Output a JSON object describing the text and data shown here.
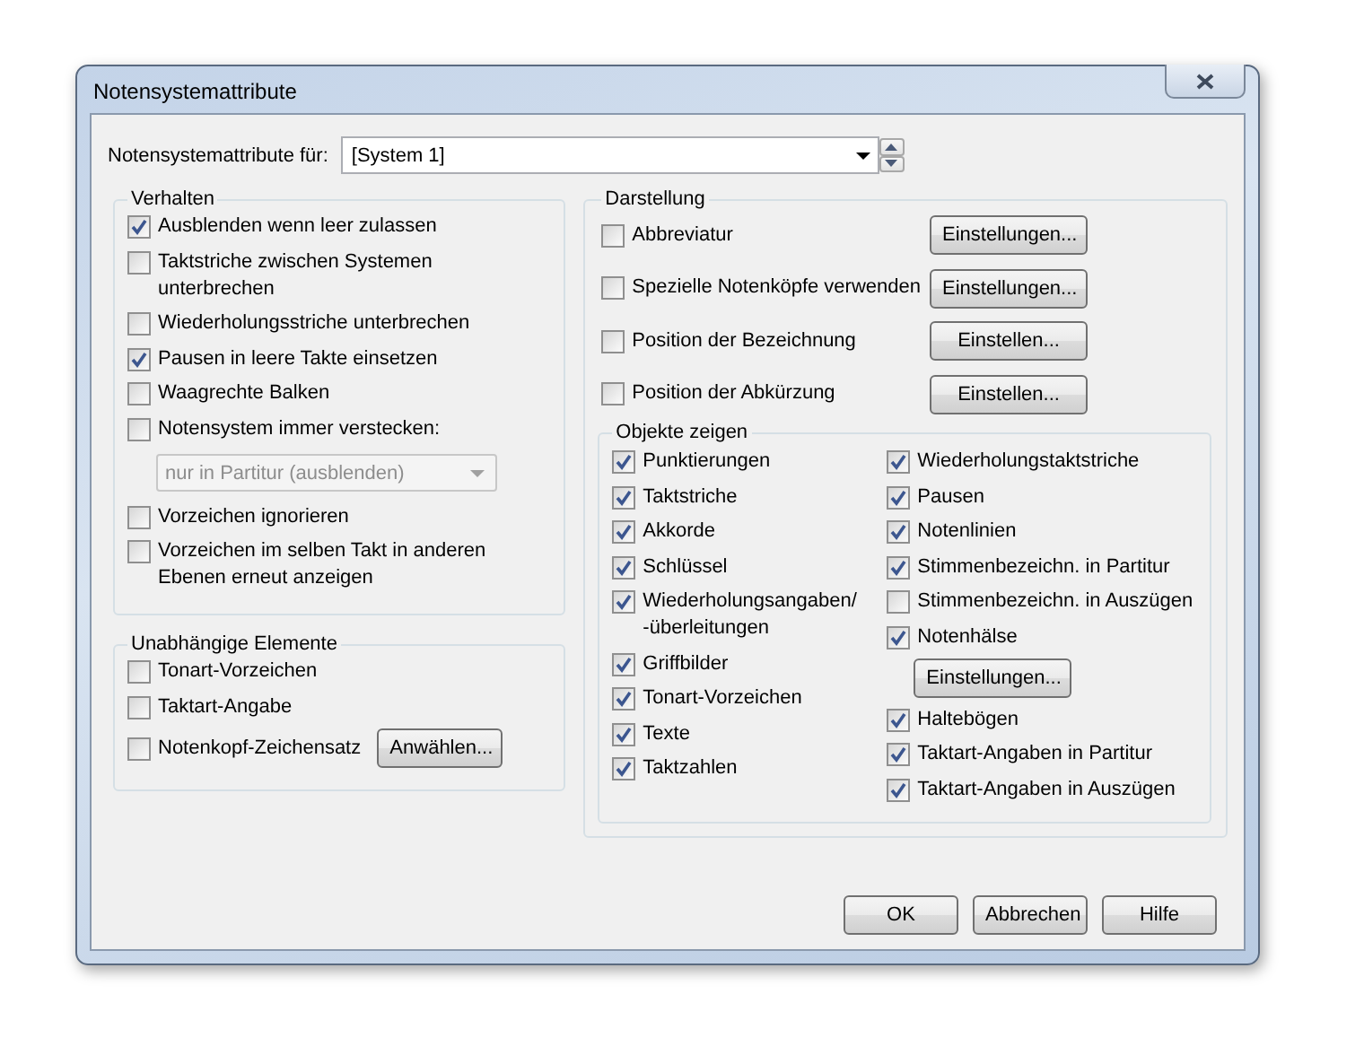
{
  "window": {
    "title": "Notensystemattribute"
  },
  "system_selector": {
    "label": "Notensystemattribute für:",
    "value": "[System 1]"
  },
  "behavior": {
    "title": "Verhalten",
    "items": [
      {
        "kind": "check",
        "label": "Ausblenden wenn leer zulassen",
        "checked": true
      },
      {
        "kind": "check",
        "label": "Taktstriche zwischen Systemen unterbrechen",
        "checked": false
      },
      {
        "kind": "check",
        "label": "Wiederholungsstriche unterbrechen",
        "checked": false
      },
      {
        "kind": "check",
        "label": "Pausen in leere Takte einsetzen",
        "checked": true
      },
      {
        "kind": "check",
        "label": "Waagrechte Balken",
        "checked": false
      },
      {
        "kind": "check",
        "label": "Notensystem immer verstecken:",
        "checked": false
      },
      {
        "kind": "dropdown",
        "value": "nur in Partitur (ausblenden)",
        "disabled": true
      },
      {
        "kind": "check",
        "label": "Vorzeichen ignorieren",
        "checked": false
      },
      {
        "kind": "check",
        "label": "Vorzeichen im selben Takt in anderen Ebenen erneut anzeigen",
        "checked": false
      }
    ]
  },
  "independent": {
    "title": "Unabhängige Elemente",
    "items": [
      {
        "kind": "check",
        "label": "Tonart-Vorzeichen",
        "checked": false
      },
      {
        "kind": "check",
        "label": "Taktart-Angabe",
        "checked": false
      },
      {
        "kind": "check",
        "label": "Notenkopf-Zeichensatz",
        "checked": false,
        "button": "Anwählen..."
      }
    ]
  },
  "display": {
    "title": "Darstellung",
    "items": [
      {
        "label": "Abbreviatur",
        "checked": false,
        "button": "Einstellungen..."
      },
      {
        "label": "Spezielle Notenköpfe verwenden",
        "checked": false,
        "button": "Einstellungen..."
      },
      {
        "label": "Position der Bezeichnung",
        "checked": false,
        "button": "Einstellen..."
      },
      {
        "label": "Position der Abkürzung",
        "checked": false,
        "button": "Einstellen..."
      }
    ]
  },
  "show_objects": {
    "title": "Objekte zeigen",
    "columns": [
      [
        {
          "kind": "check",
          "label": "Punktierungen",
          "checked": true
        },
        {
          "kind": "check",
          "label": "Taktstriche",
          "checked": true
        },
        {
          "kind": "check",
          "label": "Akkorde",
          "checked": true
        },
        {
          "kind": "check",
          "label": "Schlüssel",
          "checked": true
        },
        {
          "kind": "check",
          "label": "Wiederholungsangaben/ -überleitungen",
          "checked": true
        },
        {
          "kind": "check",
          "label": "Griffbilder",
          "checked": true
        },
        {
          "kind": "check",
          "label": "Tonart-Vorzeichen",
          "checked": true
        },
        {
          "kind": "check",
          "label": "Texte",
          "checked": true
        },
        {
          "kind": "check",
          "label": "Taktzahlen",
          "checked": true
        }
      ],
      [
        {
          "kind": "check",
          "label": "Wiederholungstaktstriche",
          "checked": true
        },
        {
          "kind": "check",
          "label": "Pausen",
          "checked": true
        },
        {
          "kind": "check",
          "label": "Notenlinien",
          "checked": true
        },
        {
          "kind": "check",
          "label": "Stimmenbezeichn. in Partitur",
          "checked": true
        },
        {
          "kind": "check",
          "label": "Stimmenbezeichn. in Auszügen",
          "checked": false
        },
        {
          "kind": "check",
          "label": "Notenhälse",
          "checked": true
        },
        {
          "kind": "button",
          "label": "Einstellungen..."
        },
        {
          "kind": "check",
          "label": "Haltebögen",
          "checked": true
        },
        {
          "kind": "check",
          "label": "Taktart-Angaben in Partitur",
          "checked": true
        },
        {
          "kind": "check",
          "label": "Taktart-Angaben in Auszügen",
          "checked": true
        }
      ]
    ]
  },
  "buttons": [
    "OK",
    "Abbrechen",
    "Hilfe"
  ]
}
